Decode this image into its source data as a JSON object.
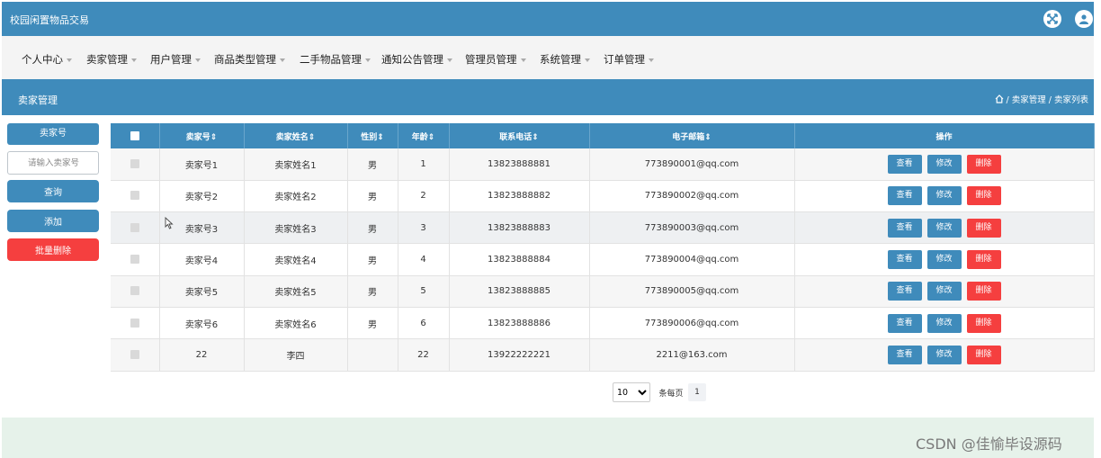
{
  "app": {
    "title": "校园闲置物品交易"
  },
  "nav": {
    "items": [
      {
        "label": "个人中心"
      },
      {
        "label": "卖家管理"
      },
      {
        "label": "用户管理"
      },
      {
        "label": "商品类型管理"
      },
      {
        "label": "二手物品管理"
      },
      {
        "label": "通知公告管理"
      },
      {
        "label": "管理员管理"
      },
      {
        "label": "系统管理"
      },
      {
        "label": "订单管理"
      }
    ]
  },
  "page": {
    "title": "卖家管理",
    "breadcrumb": "/ 卖家管理 / 卖家列表"
  },
  "search": {
    "label": "卖家号",
    "placeholder": "请输入卖家号",
    "query_label": "查询",
    "add_label": "添加",
    "batch_delete_label": "批量删除"
  },
  "table": {
    "columns": [
      "卖家号",
      "卖家姓名",
      "性别",
      "年龄",
      "联系电话",
      "电子邮箱",
      "操作"
    ],
    "rows": [
      {
        "id": "卖家号1",
        "name": "卖家姓名1",
        "gender": "男",
        "age": "1",
        "phone": "13823888881",
        "email": "773890001@qq.com"
      },
      {
        "id": "卖家号2",
        "name": "卖家姓名2",
        "gender": "男",
        "age": "2",
        "phone": "13823888882",
        "email": "773890002@qq.com"
      },
      {
        "id": "卖家号3",
        "name": "卖家姓名3",
        "gender": "男",
        "age": "3",
        "phone": "13823888883",
        "email": "773890003@qq.com"
      },
      {
        "id": "卖家号4",
        "name": "卖家姓名4",
        "gender": "男",
        "age": "4",
        "phone": "13823888884",
        "email": "773890004@qq.com"
      },
      {
        "id": "卖家号5",
        "name": "卖家姓名5",
        "gender": "男",
        "age": "5",
        "phone": "13823888885",
        "email": "773890005@qq.com"
      },
      {
        "id": "卖家号6",
        "name": "卖家姓名6",
        "gender": "男",
        "age": "6",
        "phone": "13823888886",
        "email": "773890006@qq.com"
      },
      {
        "id": "22",
        "name": "李四",
        "gender": "",
        "age": "22",
        "phone": "13922222221",
        "email": "2211@163.com"
      }
    ],
    "actions": {
      "view": "查看",
      "edit": "修改",
      "delete": "删除"
    }
  },
  "pagination": {
    "page_size": "10",
    "per_page_label": "条每页",
    "current_page": "1"
  },
  "watermark": "CSDN @佳愉毕设源码",
  "colors": {
    "primary": "#3f8bbb",
    "danger": "#f53f3f",
    "menu_bg": "#f4f4f4",
    "footer_bg": "#e6f2ea"
  },
  "icons": {
    "fullscreen": "fullscreen-icon",
    "user": "user-icon",
    "home": "home-icon",
    "sort": "sort-icon",
    "caret": "caret-down-icon"
  }
}
